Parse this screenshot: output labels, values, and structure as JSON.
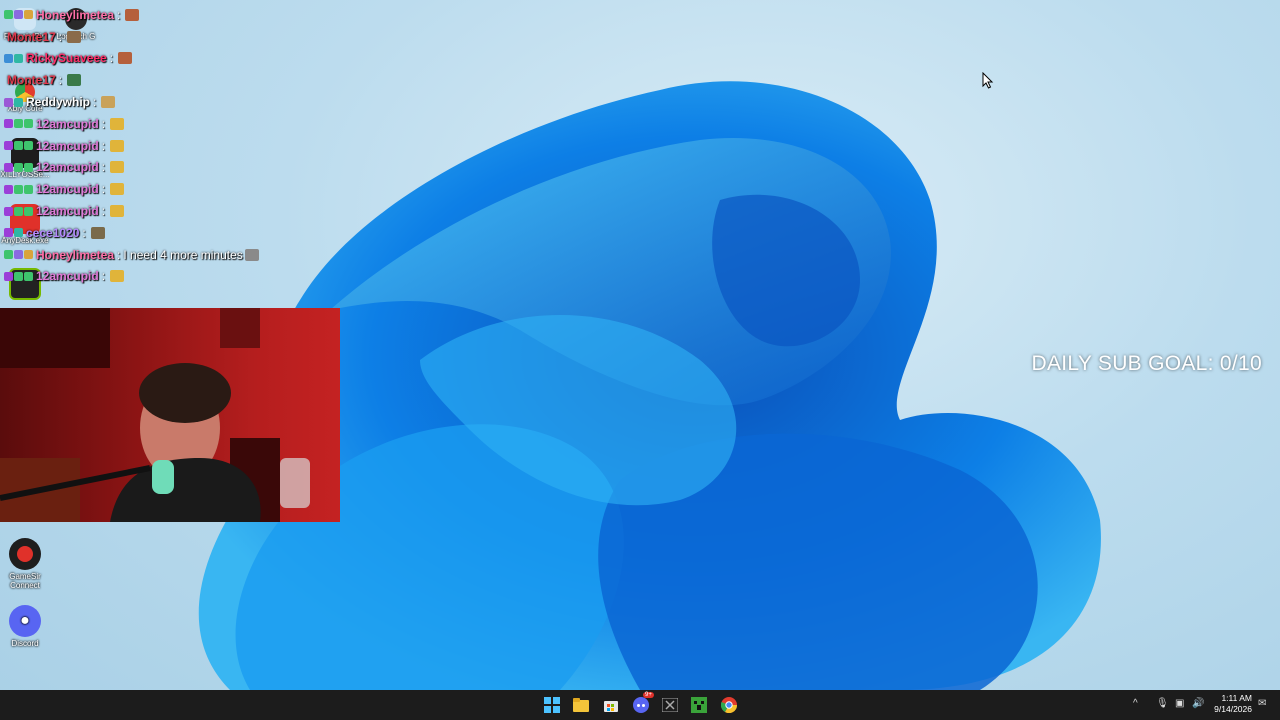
{
  "desktop": {
    "icons": [
      {
        "label": "Recycle Bin",
        "name": "recycle-bin"
      },
      {
        "label": "Logitech G",
        "name": "logitech-g"
      },
      {
        "label": "Xbly Core",
        "name": "xbly-core"
      },
      {
        "label": "XILLYOSSe...",
        "name": "xillyossi"
      },
      {
        "label": "AnyDesk.exe",
        "name": "anydesk"
      },
      {
        "label": "GameSir Connect",
        "name": "gamesir-connect"
      },
      {
        "label": "Discord",
        "name": "discord"
      }
    ]
  },
  "chat": {
    "messages": [
      {
        "user": "Honeylimetea",
        "color": "#ff6fa8",
        "text": "",
        "badges": [
          "#3ec46d",
          "#8a6be0",
          "#d9a43c"
        ],
        "emote": "#b5603c"
      },
      {
        "user": "Monte17",
        "color": "#e03a4e",
        "text": "",
        "badges": [],
        "emote": "#8a6b4a"
      },
      {
        "user": "RickySuaveee",
        "color": "#ff2e6a",
        "text": "",
        "badges": [
          "#3b8ed6",
          "#2fb8a4"
        ],
        "emote": "#b5603c"
      },
      {
        "user": "Monte17",
        "color": "#e03a4e",
        "text": "",
        "badges": [],
        "emote": "#3a7a4a"
      },
      {
        "user": "Reddywhip",
        "color": "#ffffff",
        "text": "",
        "badges": [
          "#9b59d6",
          "#2fb8a4"
        ],
        "emote": "#c9a25a"
      },
      {
        "user": "12amcupid",
        "color": "#e07ad8",
        "text": "",
        "badges": [
          "#9b3fd8",
          "#3ec46d",
          "#3ec46d"
        ],
        "emote": "#e0b43a"
      },
      {
        "user": "12amcupid",
        "color": "#e07ad8",
        "text": "",
        "badges": [
          "#9b3fd8",
          "#3ec46d",
          "#3ec46d"
        ],
        "emote": "#e0b43a"
      },
      {
        "user": "12amcupid",
        "color": "#e07ad8",
        "text": "",
        "badges": [
          "#9b3fd8",
          "#3ec46d",
          "#3ec46d"
        ],
        "emote": "#e0b43a"
      },
      {
        "user": "12amcupid",
        "color": "#e07ad8",
        "text": "",
        "badges": [
          "#9b3fd8",
          "#3ec46d",
          "#3ec46d"
        ],
        "emote": "#e0b43a"
      },
      {
        "user": "12amcupid",
        "color": "#e07ad8",
        "text": "",
        "badges": [
          "#9b3fd8",
          "#3ec46d",
          "#3ec46d"
        ],
        "emote": "#e0b43a"
      },
      {
        "user": "cece1020",
        "color": "#b589ff",
        "text": "",
        "badges": [
          "#9b3fd8",
          "#2fb8a4"
        ],
        "emote": "#7a6a4a"
      },
      {
        "user": "Honeylimetea",
        "color": "#ff6fa8",
        "text": "I need 4 more minutes",
        "badges": [
          "#3ec46d",
          "#8a6be0",
          "#d9a43c"
        ],
        "emote": "#8a8a8a"
      },
      {
        "user": "12amcupid",
        "color": "#e07ad8",
        "text": "",
        "badges": [
          "#9b3fd8",
          "#3ec46d",
          "#3ec46d"
        ],
        "emote": "#e0b43a"
      }
    ]
  },
  "overlay": {
    "sub_goal": "DAILY SUB GOAL: 0/10"
  },
  "taskbar": {
    "apps": [
      "start-icon",
      "file-explorer-icon",
      "store-icon",
      "discord-taskbar-icon",
      "excel-icon",
      "minecraft-icon",
      "chrome-icon"
    ],
    "discord_badge": "9+",
    "time": "1:11 AM",
    "date": "9/14/2026"
  },
  "colors": {
    "taskbar_bg": "#1c1c1c",
    "wallpaper_bloom": "#0a7de0",
    "webcam_red": "#b51e1e"
  }
}
